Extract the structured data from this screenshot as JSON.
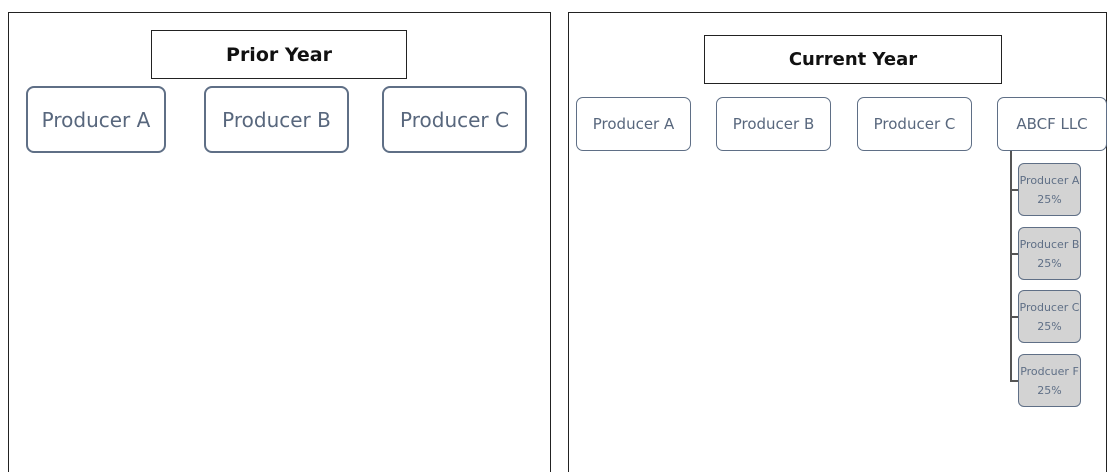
{
  "prior": {
    "title": "Prior Year",
    "producers": [
      "Producer A",
      "Producer B",
      "Producer C"
    ]
  },
  "current": {
    "title": "Current Year",
    "producers": [
      "Producer A",
      "Producer B",
      "Producer C"
    ],
    "llc": {
      "name": "ABCF LLC",
      "children": [
        {
          "name": "Producer A",
          "share": "25%"
        },
        {
          "name": "Producer B",
          "share": "25%"
        },
        {
          "name": "Producer C",
          "share": "25%"
        },
        {
          "name": "Prodcuer F",
          "share": "25%"
        }
      ]
    }
  }
}
